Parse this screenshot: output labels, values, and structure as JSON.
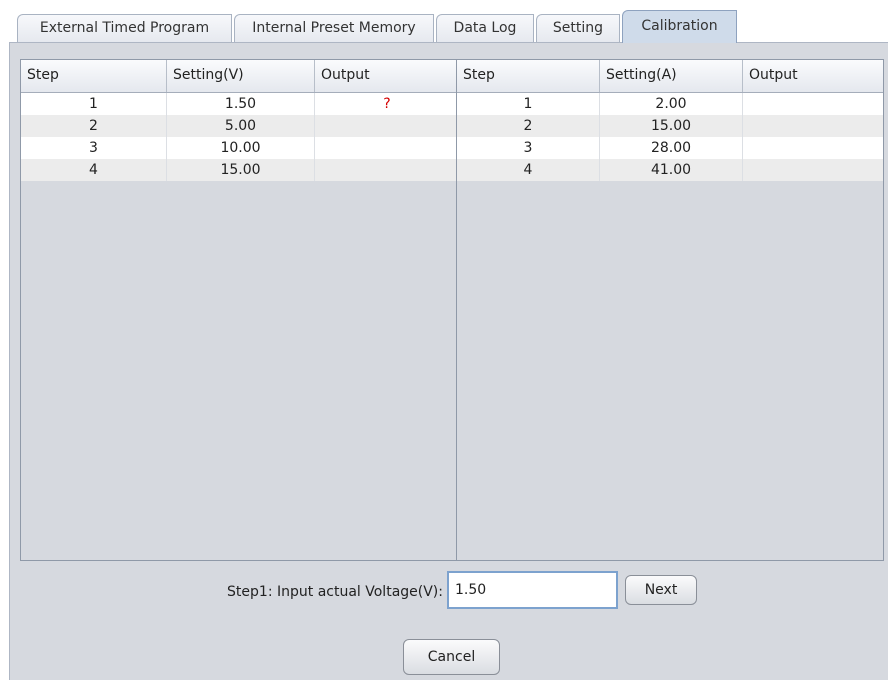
{
  "tabs": [
    {
      "label": "External Timed Program"
    },
    {
      "label": "Internal Preset Memory"
    },
    {
      "label": "Data Log"
    },
    {
      "label": "Setting"
    },
    {
      "label": "Calibration"
    }
  ],
  "active_tab": "Calibration",
  "voltage_table": {
    "columns": [
      "Step",
      "Setting(V)",
      "Output"
    ],
    "rows": [
      {
        "step": "1",
        "setting": "1.50",
        "output": "?"
      },
      {
        "step": "2",
        "setting": "5.00",
        "output": ""
      },
      {
        "step": "3",
        "setting": "10.00",
        "output": ""
      },
      {
        "step": "4",
        "setting": "15.00",
        "output": ""
      }
    ]
  },
  "current_table": {
    "columns": [
      "Step",
      "Setting(A)",
      "Output"
    ],
    "rows": [
      {
        "step": "1",
        "setting": "2.00",
        "output": ""
      },
      {
        "step": "2",
        "setting": "15.00",
        "output": ""
      },
      {
        "step": "3",
        "setting": "28.00",
        "output": ""
      },
      {
        "step": "4",
        "setting": "41.00",
        "output": ""
      }
    ]
  },
  "calibration": {
    "prompt_label": "Step1: Input actual Voltage(V):",
    "input_value": "1.50",
    "next_label": "Next",
    "cancel_label": "Cancel"
  },
  "colors": {
    "pending_marker": "#d40000",
    "active_tab": "#cfdbea",
    "panel": "#d6d9df"
  }
}
